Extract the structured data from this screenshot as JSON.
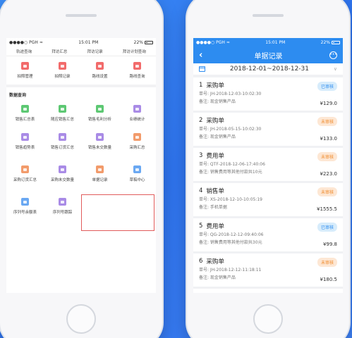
{
  "left": {
    "status": {
      "carrier": "PGH",
      "time": "15:01 PM",
      "battery": "22%"
    },
    "top_row": [
      "轨迹查询",
      "拜访汇总",
      "拜访记录",
      "拜访计划查询"
    ],
    "row1": [
      {
        "label": "拍照管理",
        "color": "#f26b6b"
      },
      {
        "label": "拍照记录",
        "color": "#f26b6b"
      },
      {
        "label": "路线设置",
        "color": "#f26b6b"
      },
      {
        "label": "路线查询",
        "color": "#f26b6b"
      }
    ],
    "section_title": "数据查询",
    "row2": [
      {
        "label": "销售汇总表",
        "color": "#5dc873"
      },
      {
        "label": "随应销售汇总",
        "color": "#5dc873"
      },
      {
        "label": "销售毛利分析",
        "color": "#5dc873"
      },
      {
        "label": "业绩统计",
        "color": "#a98be6"
      }
    ],
    "row3": [
      {
        "label": "销售趋势表",
        "color": "#a98be6"
      },
      {
        "label": "销售订货汇总",
        "color": "#a98be6"
      },
      {
        "label": "销售未交数量",
        "color": "#a98be6"
      },
      {
        "label": "采购汇总",
        "color": "#f29b6b"
      }
    ],
    "row4": [
      {
        "label": "采购订货汇总",
        "color": "#f29b6b"
      },
      {
        "label": "采购未交数量",
        "color": "#a98be6"
      },
      {
        "label": "单据记录",
        "color": "#f29b6b"
      },
      {
        "label": "草稿中心",
        "color": "#6aa8f2"
      }
    ],
    "row5": [
      {
        "label": "序列号余额表",
        "color": "#6aa8f2"
      },
      {
        "label": "序列号跟踪",
        "color": "#a98be6"
      }
    ]
  },
  "right": {
    "status": {
      "carrier": "PGH",
      "time": "15:01 PM",
      "battery": "22%"
    },
    "nav_title": "单据记录",
    "date_range": "2018-12-01~2018-12-31",
    "records": [
      {
        "index": "1",
        "type": "采购单",
        "no": "单号: JH-2018-12-03-10:02:30",
        "note": "备注: 现金销售产品",
        "status": "已审核",
        "status_kind": "ok",
        "amount": "¥129.0"
      },
      {
        "index": "2",
        "type": "采购单",
        "no": "单号: JH-2018-05-15-10:02:30",
        "note": "备注: 现金销售产品",
        "status": "未审核",
        "status_kind": "pending",
        "amount": "¥133.0"
      },
      {
        "index": "3",
        "type": "费用单",
        "no": "单号: QTF-2018-12-06-17:40:06",
        "note": "备注: 销售费用等其他付款共10元",
        "status": "未审核",
        "status_kind": "pending",
        "amount": "¥223.0"
      },
      {
        "index": "4",
        "type": "销售单",
        "no": "单号: XS-2018-12-10-10:05:19",
        "note": "备注: 手机单据",
        "status": "未审核",
        "status_kind": "pending",
        "amount": "¥1555.5"
      },
      {
        "index": "5",
        "type": "费用单",
        "no": "单号: QG-2018-12-12-09:40:06",
        "note": "备注: 销售费用等其他付款共30元",
        "status": "已审核",
        "status_kind": "ok",
        "amount": "¥99.8"
      },
      {
        "index": "6",
        "type": "采购单",
        "no": "单号: JH-2018-12-12-11:18:11",
        "note": "备注: 现金销售产品",
        "status": "未审核",
        "status_kind": "pending",
        "amount": "¥180.5"
      }
    ]
  }
}
